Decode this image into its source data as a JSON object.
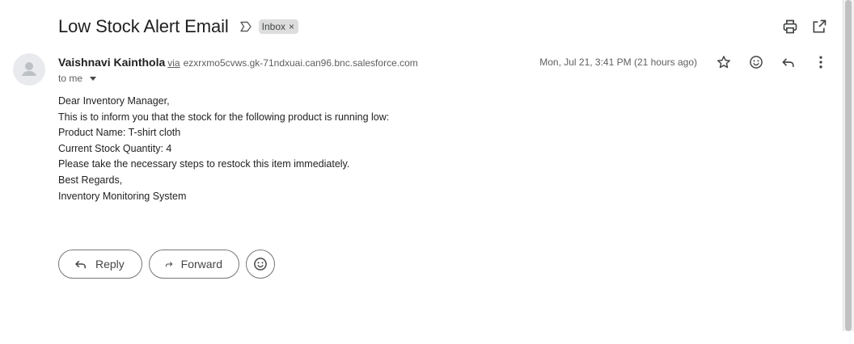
{
  "email": {
    "subject": "Low Stock Alert Email",
    "label": "Inbox",
    "label_remove": "×",
    "sender_name": "Vaishnavi Kainthola",
    "via": "via",
    "via_address": "ezxrxmo5cvws.gk-71ndxuai.can96.bnc.salesforce.com",
    "recipient": "to me",
    "timestamp": "Mon, Jul 21, 3:41 PM (21 hours ago)",
    "body_lines": [
      "Dear Inventory Manager,",
      "This is to inform you that the stock for the following product is running low:",
      "Product Name: T-shirt cloth",
      "Current Stock Quantity: 4",
      "Please take the necessary steps to restock this item immediately.",
      "Best Regards,",
      "Inventory Monitoring System"
    ]
  },
  "actions": {
    "reply_label": "Reply",
    "forward_label": "Forward"
  },
  "icons": {
    "importance": "importance-marker-icon",
    "print": "print-icon",
    "open_new_window": "open-in-new-icon",
    "star": "star-icon",
    "emoji": "emoji-icon",
    "reply": "reply-icon",
    "more": "more-vert-icon",
    "forward": "forward-icon",
    "avatar": "person-icon"
  },
  "colors": {
    "text": "#1f1f1f",
    "muted": "#5e5e5e",
    "chip_bg": "#dddddd",
    "border": "#747775"
  }
}
